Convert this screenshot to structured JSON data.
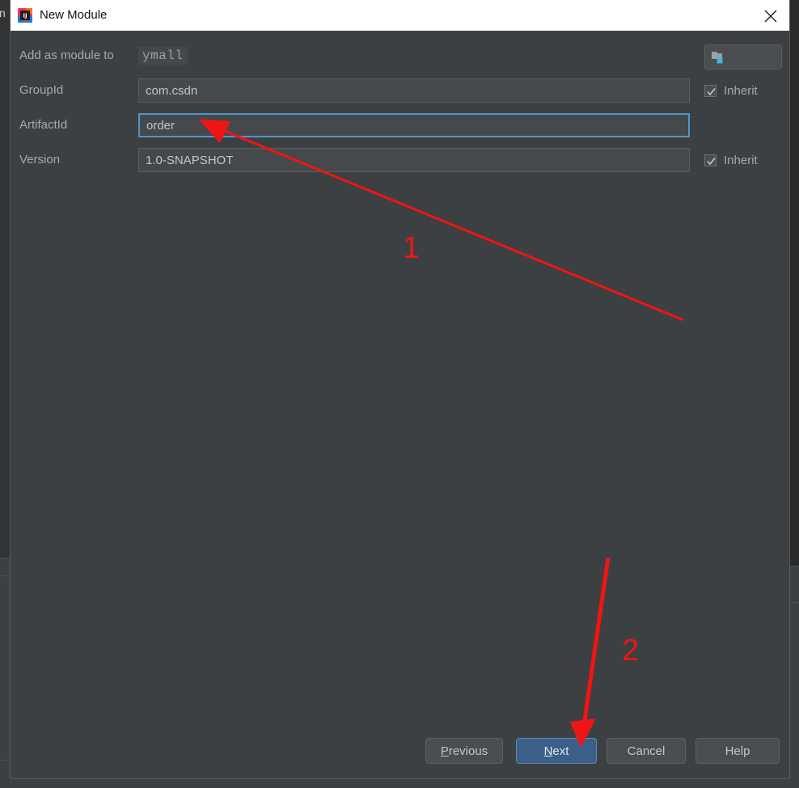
{
  "window": {
    "title": "New Module",
    "app_icon": "intellij-idea-icon",
    "close_icon": "close-icon"
  },
  "ide_background": {
    "left_edge_text": "n",
    "right_icon": "chart-icon"
  },
  "form": {
    "fields": [
      {
        "label": "Add as module to",
        "value": "ymall",
        "type": "module-selector",
        "name": "add-as-module-to",
        "focused": false
      },
      {
        "label": "GroupId",
        "value": "com.csdn",
        "type": "text",
        "name": "group-id",
        "focused": false
      },
      {
        "label": "ArtifactId",
        "value": "order",
        "type": "text",
        "name": "artifact-id",
        "focused": true
      },
      {
        "label": "Version",
        "value": "1.0-SNAPSHOT",
        "type": "text",
        "name": "version",
        "focused": false
      }
    ],
    "browse": {
      "icon": "module-folder-icon",
      "tooltip": ""
    },
    "inherit_group": {
      "label": "Inherit",
      "checked": true
    },
    "inherit_version": {
      "label": "Inherit",
      "checked": true
    }
  },
  "buttons": {
    "previous": {
      "label": "Previous",
      "mnemonic": "P",
      "primary": false
    },
    "next": {
      "label": "Next",
      "mnemonic": "N",
      "primary": true
    },
    "cancel": {
      "label": "Cancel",
      "mnemonic": "",
      "primary": false
    },
    "help": {
      "label": "Help",
      "mnemonic": "",
      "primary": false
    }
  },
  "annotations": {
    "color": "#f11414",
    "step_one": {
      "label": "1"
    },
    "step_two": {
      "label": "2"
    }
  }
}
